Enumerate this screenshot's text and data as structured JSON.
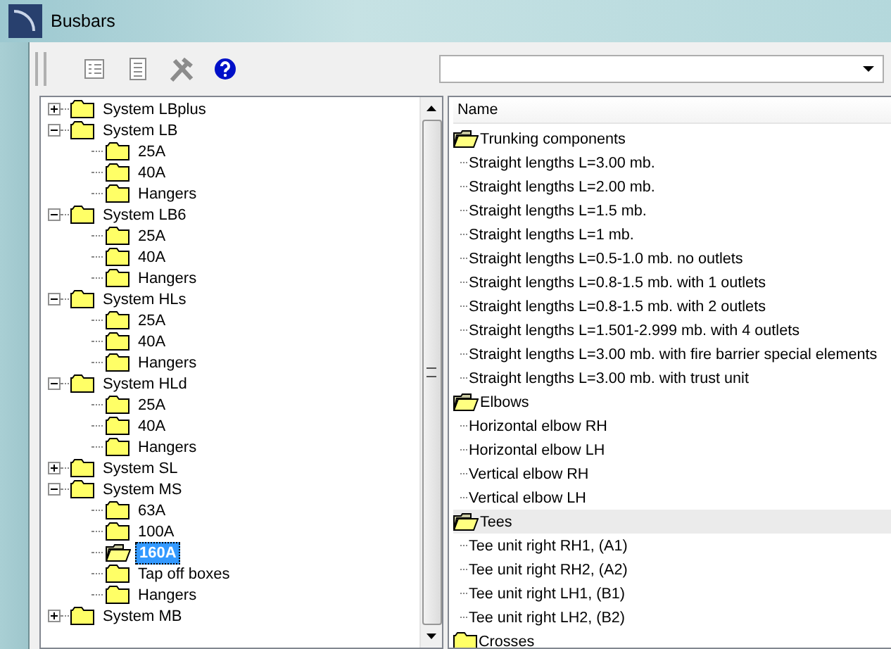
{
  "window": {
    "title": "Busbars"
  },
  "toolbar": [
    {
      "kind": "properties",
      "disabled": true
    },
    {
      "kind": "document",
      "disabled": true
    },
    {
      "kind": "tools",
      "disabled": true
    },
    {
      "kind": "help",
      "disabled": false
    }
  ],
  "tree": [
    {
      "label": "System LBplus",
      "expanded": false,
      "selected": false
    },
    {
      "label": "System LB",
      "expanded": true,
      "selected": false,
      "children": [
        {
          "label": "25A",
          "selected": false
        },
        {
          "label": "40A",
          "selected": false
        },
        {
          "label": "Hangers",
          "selected": false
        }
      ]
    },
    {
      "label": "System LB6",
      "expanded": true,
      "selected": false,
      "children": [
        {
          "label": "25A",
          "selected": false
        },
        {
          "label": "40A",
          "selected": false
        },
        {
          "label": "Hangers",
          "selected": false
        }
      ]
    },
    {
      "label": "System HLs",
      "expanded": true,
      "selected": false,
      "children": [
        {
          "label": "25A",
          "selected": false
        },
        {
          "label": "40A",
          "selected": false
        },
        {
          "label": "Hangers",
          "selected": false
        }
      ]
    },
    {
      "label": "System HLd",
      "expanded": true,
      "selected": false,
      "children": [
        {
          "label": "25A",
          "selected": false
        },
        {
          "label": "40A",
          "selected": false
        },
        {
          "label": "Hangers",
          "selected": false
        }
      ]
    },
    {
      "label": "System SL",
      "expanded": false,
      "selected": false
    },
    {
      "label": "System MS",
      "expanded": true,
      "selected": false,
      "children": [
        {
          "label": "63A",
          "selected": false
        },
        {
          "label": "100A",
          "selected": false
        },
        {
          "label": "160A",
          "selected": true
        },
        {
          "label": "Tap off boxes",
          "selected": false
        },
        {
          "label": "Hangers",
          "selected": false
        }
      ]
    },
    {
      "label": "System MB",
      "expanded": false,
      "selected": false
    }
  ],
  "list": {
    "column": "Name",
    "groups": [
      {
        "label": "Trunking components",
        "expanded": true,
        "hovered": false,
        "items": [
          "Straight lengths L=3.00 mb.",
          "Straight lengths L=2.00 mb.",
          "Straight lengths L=1.5 mb.",
          "Straight lengths L=1 mb.",
          "Straight lengths L=0.5-1.0 mb. no outlets",
          "Straight lengths L=0.8-1.5 mb. with 1 outlets",
          "Straight lengths L=0.8-1.5 mb. with 2 outlets",
          "Straight lengths L=1.501-2.999 mb. with 4 outlets",
          "Straight lengths L=3.00 mb. with fire barrier special elements",
          "Straight lengths L=3.00 mb. with trust unit"
        ]
      },
      {
        "label": "Elbows",
        "expanded": true,
        "hovered": false,
        "items": [
          "Horizontal elbow RH",
          "Horizontal elbow LH",
          "Vertical elbow RH",
          "Vertical elbow LH"
        ]
      },
      {
        "label": "Tees",
        "expanded": true,
        "hovered": true,
        "items": [
          "Tee unit right RH1, (A1)",
          "Tee unit right RH2, (A2)",
          "Tee unit right LH1, (B1)",
          "Tee unit right LH2, (B2)"
        ]
      },
      {
        "label": "Crosses",
        "expanded": false,
        "hovered": false
      }
    ]
  }
}
